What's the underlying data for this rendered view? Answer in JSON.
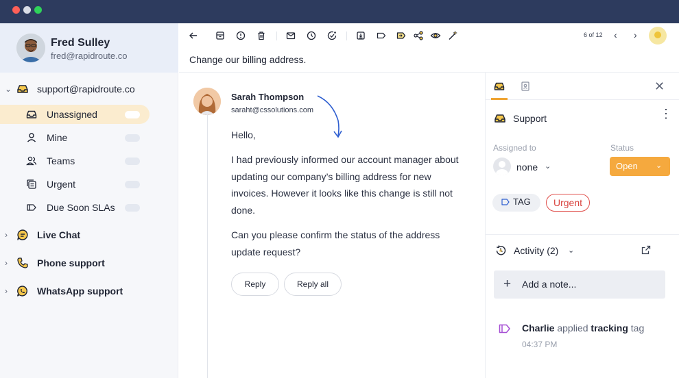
{
  "sidebar": {
    "profile": {
      "name": "Fred Sulley",
      "email": "fred@rapidroute.co"
    },
    "accounts": [
      {
        "label": "support@rapidroute.co",
        "icon": "inbox-icon",
        "expanded": true
      },
      {
        "label": "Live Chat",
        "icon": "chat-bubble-icon",
        "expanded": false
      },
      {
        "label": "Phone support",
        "icon": "phone-icon",
        "expanded": false
      },
      {
        "label": "WhatsApp support",
        "icon": "whatsapp-icon",
        "expanded": false
      }
    ],
    "folders": [
      {
        "label": "Unassigned",
        "icon": "inbox-icon",
        "active": true
      },
      {
        "label": "Mine",
        "icon": "person-icon",
        "active": false
      },
      {
        "label": "Teams",
        "icon": "people-icon",
        "active": false
      },
      {
        "label": "Urgent",
        "icon": "stack-icon",
        "active": false
      },
      {
        "label": "Due Soon SLAs",
        "icon": "tag-icon",
        "active": false
      }
    ]
  },
  "toolbar": {
    "icons": [
      "back-arrow-icon",
      "archive-icon",
      "alert-icon",
      "trash-icon",
      "mail-icon",
      "clock-icon",
      "snooze-check-icon",
      "move-icon",
      "label-icon",
      "tag-flag-icon",
      "share-icon",
      "eye-icon",
      "magic-wand-icon"
    ],
    "page_count": "6 of 12"
  },
  "conversation": {
    "subject": "Change our billing address.",
    "sender": {
      "name": "Sarah Thompson",
      "email": "saraht@cssolutions.com"
    },
    "body": [
      "Hello,",
      "I had previously informed our account manager about updating our company’s billing address for new invoices. However it looks like this change is still not done.",
      "Can you please confirm the status of the address update request?"
    ],
    "reply_label": "Reply",
    "reply_all_label": "Reply all"
  },
  "details": {
    "inbox_name": "Support",
    "assigned_label": "Assigned to",
    "assignee": "none",
    "status_label": "Status",
    "status_value": "Open",
    "tags": {
      "tag_label": "TAG",
      "urgent_label": "Urgent"
    },
    "activity_title": "Activity (2)",
    "add_note": "Add a note...",
    "log": {
      "actor": "Charlie",
      "verb": "applied",
      "object": "tracking",
      "suffix": "tag",
      "time": "04:37 PM"
    }
  },
  "colors": {
    "accent": "#F5A93E",
    "urgent": "#E0504C",
    "titlebar": "#2D3B5E",
    "active_row": "#FBECCF",
    "arrow": "#2F5FD0"
  }
}
